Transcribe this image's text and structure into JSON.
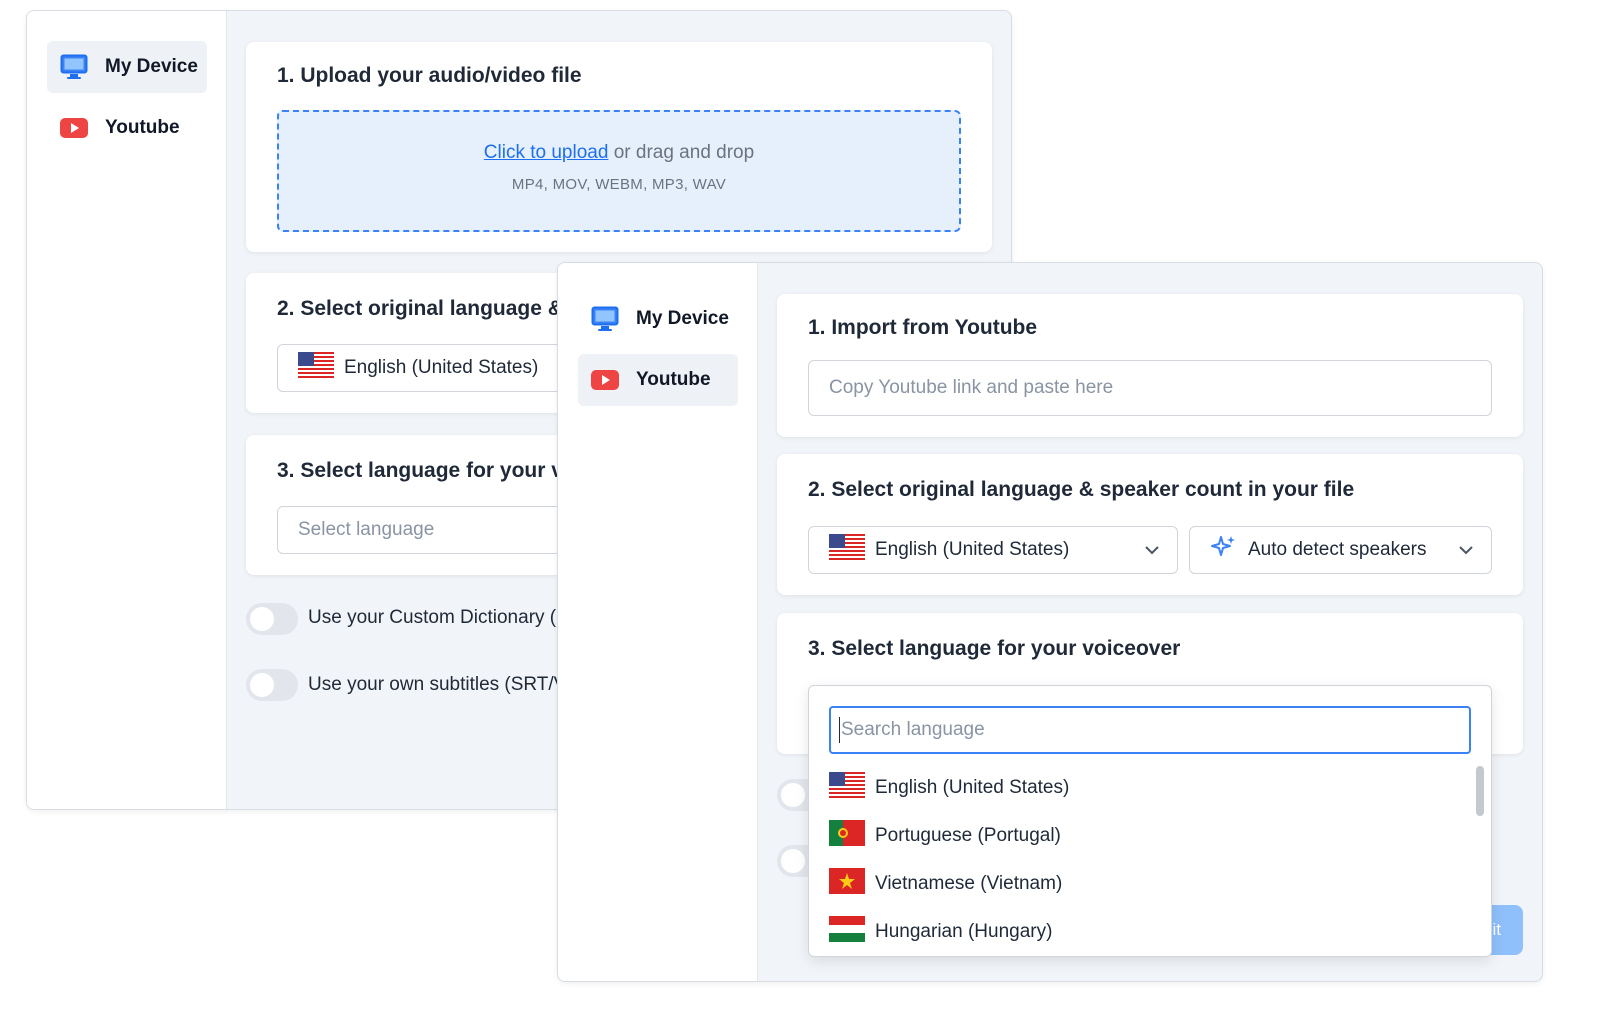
{
  "back_panel": {
    "sidebar": {
      "items": [
        {
          "label": "My Device",
          "icon": "monitor-icon",
          "active": true
        },
        {
          "label": "Youtube",
          "icon": "youtube-icon",
          "active": false
        }
      ]
    },
    "upload_card": {
      "title": "1. Upload your audio/video file",
      "link_text": "Click to upload",
      "drag_text": "or drag and drop",
      "formats": "MP4, MOV, WEBM, MP3, WAV"
    },
    "language_card": {
      "title": "2. Select original language &",
      "selected_language": "English (United States)"
    },
    "voiceover_card": {
      "title": "3. Select language for your v",
      "placeholder": "Select language"
    },
    "toggles": [
      {
        "label": "Use your Custom Dictionary ("
      },
      {
        "label": "Use your own subtitles (SRT/V"
      }
    ]
  },
  "front_panel": {
    "sidebar": {
      "items": [
        {
          "label": "My Device",
          "icon": "monitor-icon",
          "active": false
        },
        {
          "label": "Youtube",
          "icon": "youtube-icon",
          "active": true
        }
      ]
    },
    "import_card": {
      "title": "1. Import from Youtube",
      "placeholder": "Copy Youtube link and paste here"
    },
    "language_card": {
      "title": "2. Select original language & speaker count in your file",
      "selected_language": "English (United States)",
      "speakers": "Auto detect speakers"
    },
    "voiceover_card": {
      "title": "3. Select language for your voiceover"
    },
    "dropdown": {
      "search_placeholder": "Search language",
      "options": [
        {
          "label": "English (United States)",
          "flag": "us-flag"
        },
        {
          "label": "Portuguese (Portugal)",
          "flag": "portugal-flag"
        },
        {
          "label": "Vietnamese (Vietnam)",
          "flag": "vietnam-flag"
        },
        {
          "label": "Hungarian (Hungary)",
          "flag": "hungary-flag"
        }
      ]
    },
    "submit_fragment": "it"
  },
  "colors": {
    "accent": "#3b82f6",
    "youtube_red": "#ef4444",
    "panel_bg": "#f1f4f8"
  }
}
